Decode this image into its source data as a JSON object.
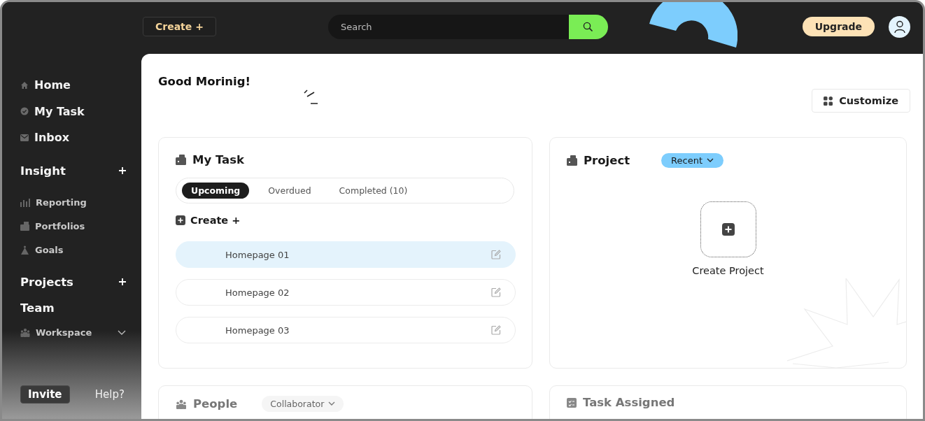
{
  "topbar": {
    "create_button": "Create +",
    "search": {
      "placeholder": "Search"
    },
    "upgrade_button": "Upgrade"
  },
  "sidebar": {
    "items": [
      {
        "label": "Home",
        "kind": "link"
      },
      {
        "label": "My Task",
        "kind": "link"
      },
      {
        "label": "Inbox",
        "kind": "link"
      },
      {
        "label": "Insight",
        "kind": "heading_add"
      },
      {
        "label": "Reporting",
        "kind": "sub"
      },
      {
        "label": "Portfolios",
        "kind": "sub"
      },
      {
        "label": "Goals",
        "kind": "sub"
      },
      {
        "label": "Projects",
        "kind": "heading_add"
      },
      {
        "label": "Team",
        "kind": "heading"
      },
      {
        "label": "Workspace",
        "kind": "sub_menu"
      }
    ],
    "invite_button": "Invite",
    "help_link": "Help?"
  },
  "main": {
    "greeting": "Good Morinig!",
    "customize_button": "Customize",
    "my_task": {
      "title": "My Task",
      "tabs": [
        {
          "label": "Upcoming",
          "selected": true
        },
        {
          "label": "Overdued",
          "selected": false
        },
        {
          "label": "Completed (10)",
          "selected": false
        }
      ],
      "create": "Create +",
      "tasks": [
        {
          "name": "Homepage 01",
          "selected": true
        },
        {
          "name": "Homepage 02",
          "selected": false
        },
        {
          "name": "Homepage 03",
          "selected": false
        }
      ]
    },
    "project": {
      "title": "Project",
      "filter": "Recent",
      "create": "Create Project"
    },
    "people": {
      "title": "People",
      "filter": "Collaborator"
    },
    "task_assigned": {
      "title": "Task Assigned"
    }
  }
}
